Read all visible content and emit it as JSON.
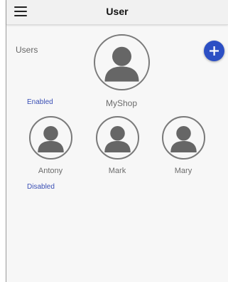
{
  "header": {
    "title": "User",
    "menu_icon": "hamburger-menu-icon"
  },
  "users_label": "Users",
  "add_button": {
    "icon": "plus-icon",
    "color": "#2c4fc4"
  },
  "owner": {
    "name": "MyShop",
    "icon": "person-avatar-icon"
  },
  "sections": {
    "enabled": "Enabled",
    "disabled": "Disabled"
  },
  "enabled_users": [
    {
      "name": "Antony",
      "icon": "person-avatar-icon"
    },
    {
      "name": "Mark",
      "icon": "person-avatar-icon"
    },
    {
      "name": "Mary",
      "icon": "person-avatar-icon"
    }
  ],
  "colors": {
    "section_label": "#3a4fb5",
    "avatar_fill": "#666666"
  }
}
